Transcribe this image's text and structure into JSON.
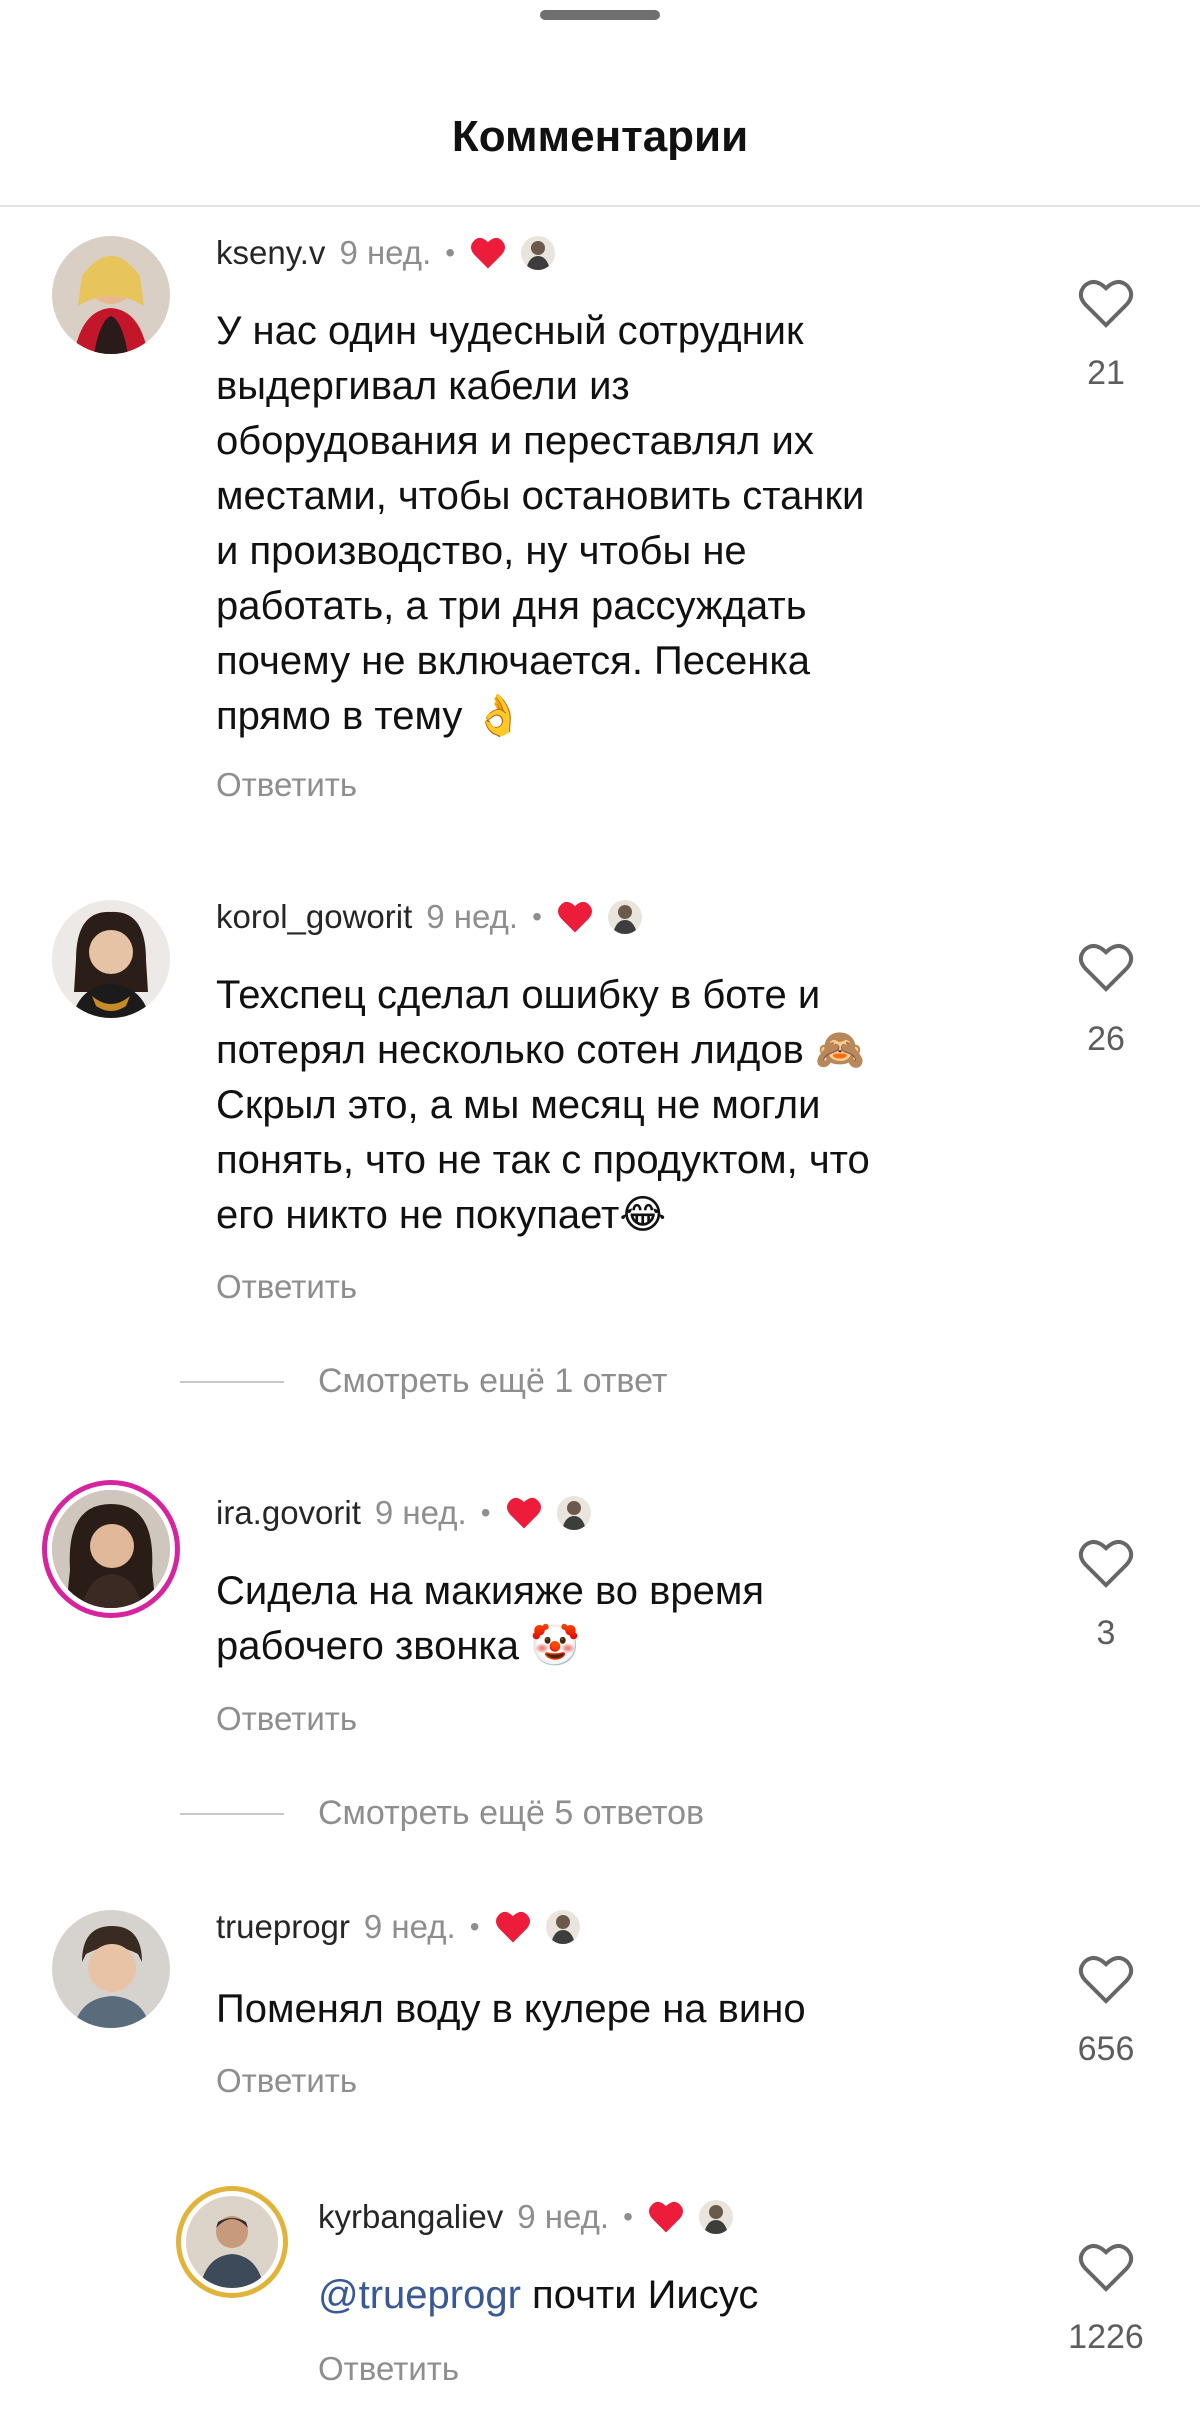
{
  "header": {
    "title": "Комментарии"
  },
  "colors": {
    "like_red": "#ed1c3a",
    "muted": "#8e8e8e",
    "mention": "#385898"
  },
  "comments": [
    {
      "username": "kseny.v",
      "time": "9 нед.",
      "text": "У нас один чудесный сотрудник\nвыдергивал кабели из\nоборудования и переставлял их\nместами, чтобы остановить станки\nи производство, ну чтобы не\nработать, а три дня рассуждать\nпочему не включается. Песенка\nпрямо в тему",
      "emoji": "👌",
      "reply_label": "Ответить",
      "likes": "21"
    },
    {
      "username": "korol_goworit",
      "time": "9 нед.",
      "text_line1": "Техспец сделал ошибку в боте и",
      "text_line2": "потерял несколько сотен лидов",
      "text_line2_emoji": "🙈",
      "text_line3": "Скрыл это, а мы месяц не могли",
      "text_line4": "понять, что не так с продуктом, что",
      "text_line5": "его никто не покупает",
      "text_line5_emoji": "😂",
      "reply_label": "Ответить",
      "likes": "26",
      "view_more": "Смотреть ещё 1 ответ"
    },
    {
      "username": "ira.govorit",
      "time": "9 нед.",
      "text": "Сидела на макияже во время\nрабочего звонка",
      "emoji": "🤡",
      "reply_label": "Ответить",
      "likes": "3",
      "view_more": "Смотреть ещё 5 ответов"
    },
    {
      "username": "trueprogr",
      "time": "9 нед.",
      "text": "Поменял воду в кулере на вино",
      "reply_label": "Ответить",
      "likes": "656"
    },
    {
      "username": "kyrbangaliev",
      "time": "9 нед.",
      "mention": "@trueprogr",
      "text": " почти Иисус",
      "reply_label": "Ответить",
      "likes": "1226"
    }
  ],
  "separator_dot": "•",
  "icons": {
    "like": "heart-outline-icon",
    "liked_by_author": "red-heart-icon"
  }
}
